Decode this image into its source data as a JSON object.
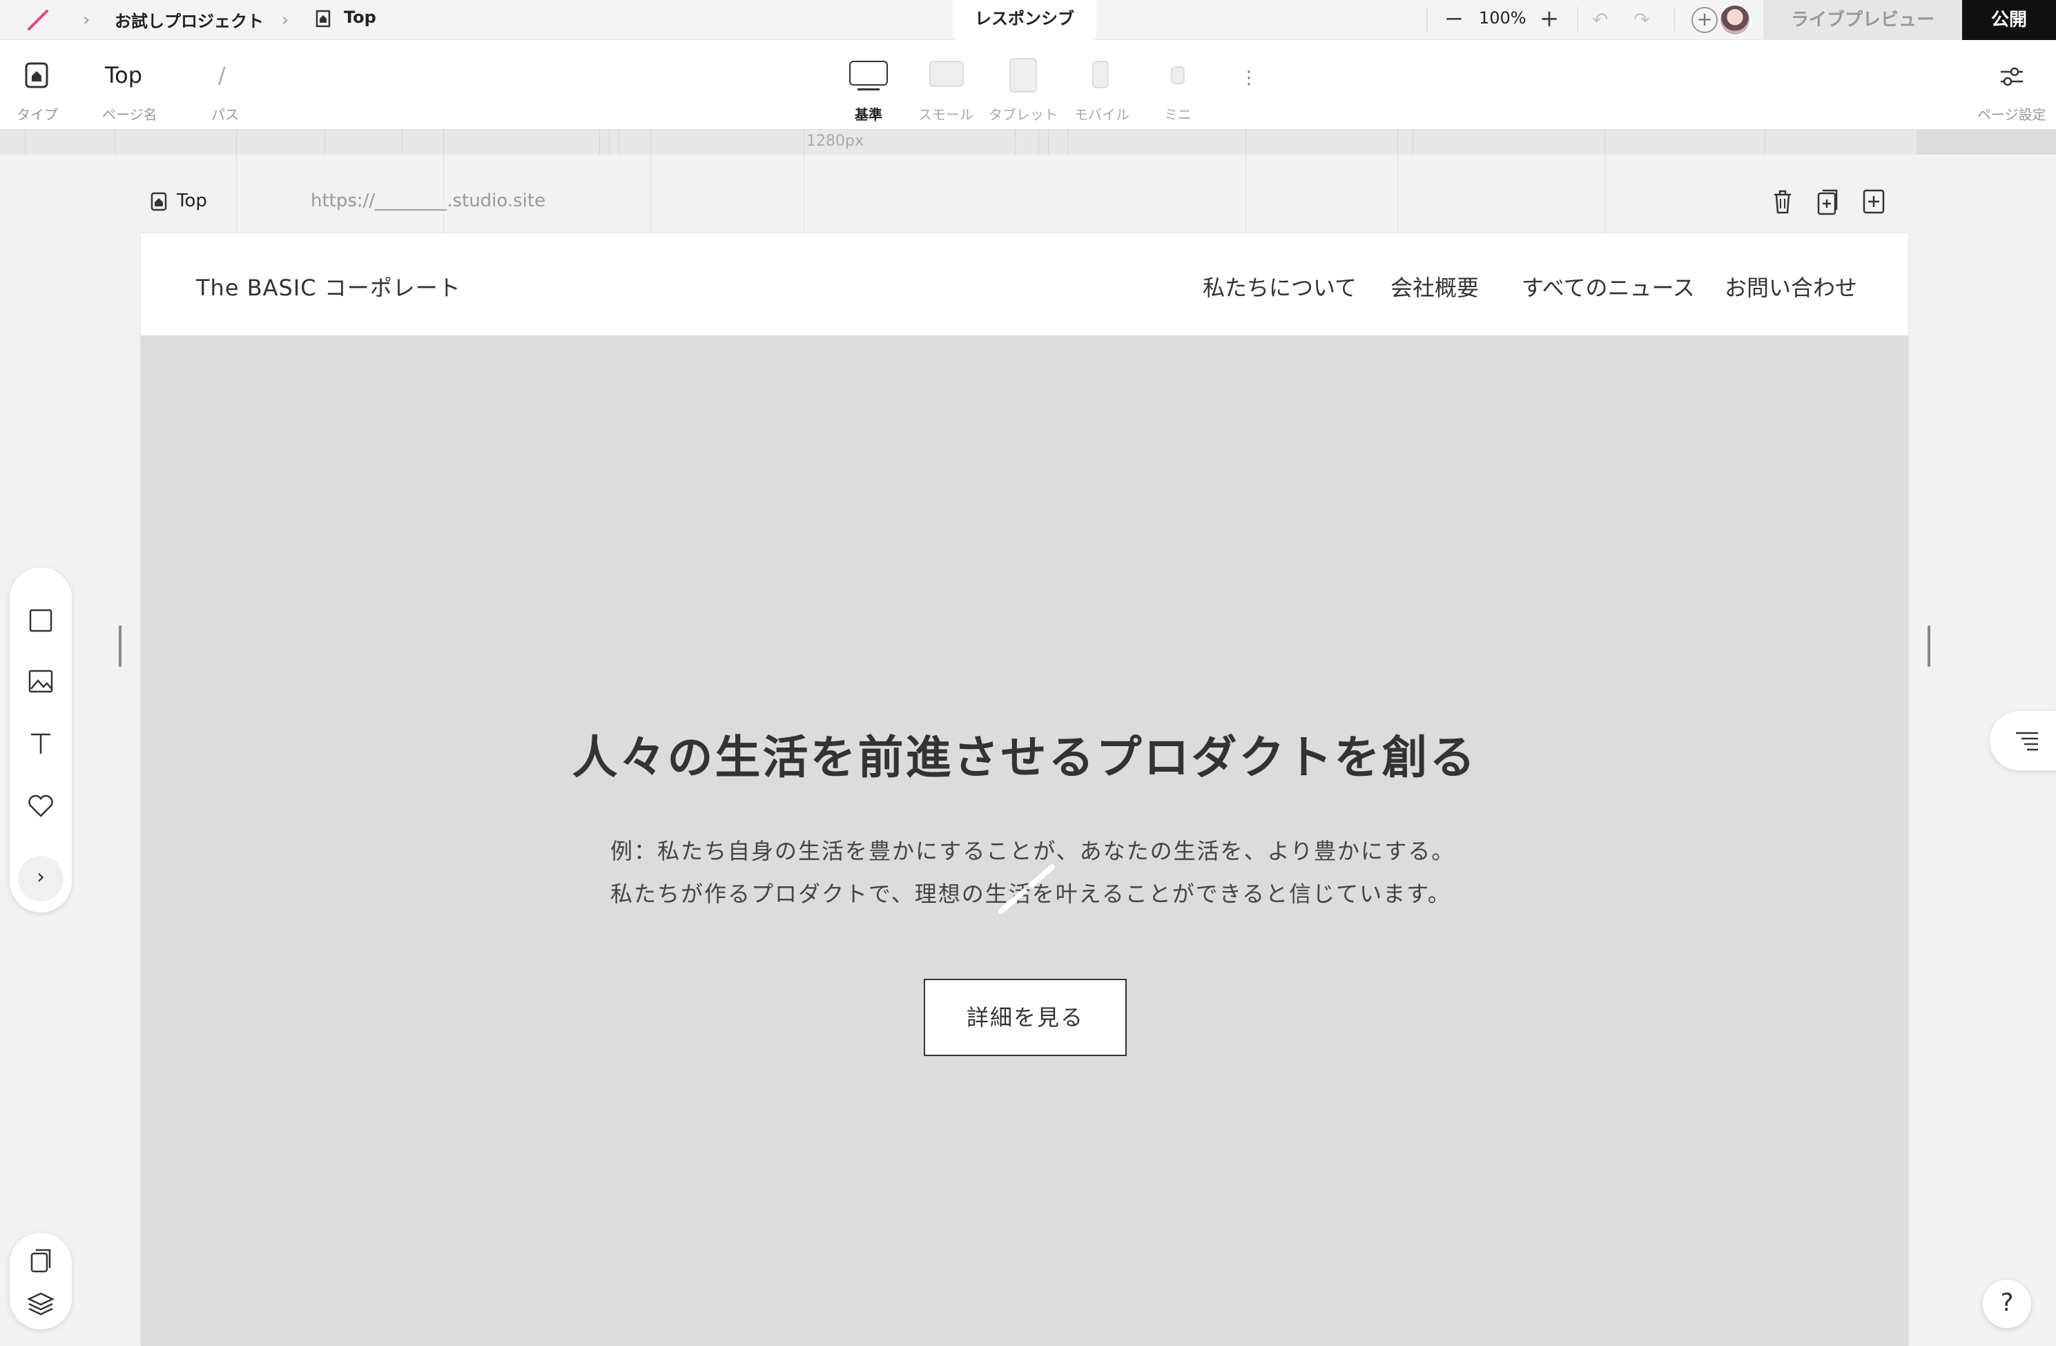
{
  "topbar": {
    "project": "お試しプロジェクト",
    "page": "Top",
    "mode_tab": "レスポンシブ",
    "zoom": "100%",
    "live_preview": "ライブプレビュー",
    "publish": "公開"
  },
  "toolbar": {
    "type_label": "タイプ",
    "page_name_label": "ページ名",
    "page_name_value": "Top",
    "path_label": "パス",
    "path_value": "/",
    "devices": [
      {
        "label": "基準",
        "active": true
      },
      {
        "label": "スモール",
        "active": false
      },
      {
        "label": "タブレット",
        "active": false
      },
      {
        "label": "モバイル",
        "active": false
      },
      {
        "label": "ミニ",
        "active": false
      }
    ],
    "page_settings_label": "ページ設定"
  },
  "ruler": {
    "width_label": "1280px"
  },
  "page_row": {
    "page_label": "Top",
    "url": "https://________.studio.site"
  },
  "site": {
    "logo": "The BASIC コーポレート",
    "nav": [
      "私たちについて",
      "会社概要",
      "すべてのニュース",
      "お問い合わせ"
    ],
    "hero_title": "人々の生活を前進させるプロダクトを創る",
    "hero_lines": [
      "例：私たち自身の生活を豊かにすることが、あなたの生活を、より豊かにする。",
      "私たちが作るプロダクトで、理想の生活を叶えることができると信じています。"
    ],
    "hero_button": "詳細を見る"
  },
  "help": "?",
  "icons": {
    "accent": "#e8418e",
    "tools": [
      "box-icon",
      "image-icon",
      "text-icon",
      "heart-icon",
      "chevron-right-icon"
    ],
    "bottom_tools": [
      "pages-icon",
      "layers-icon"
    ]
  }
}
